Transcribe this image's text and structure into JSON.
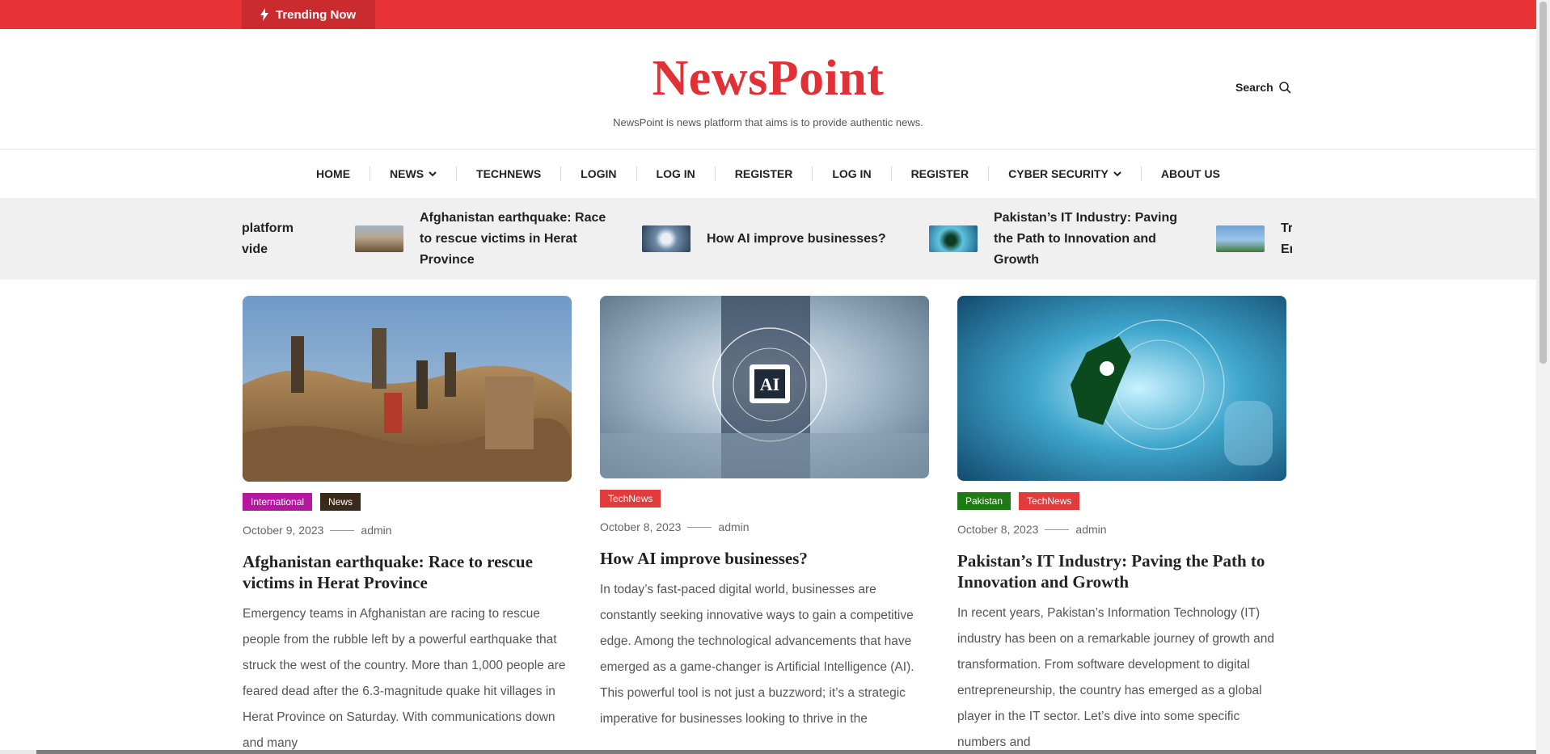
{
  "topbar": {
    "trending_label": "Trending Now",
    "accent": "#e93437"
  },
  "header": {
    "brand": "NewsPoint",
    "tagline": "NewsPoint is news platform that aims is to provide authentic news.",
    "search_label": "Search"
  },
  "nav": {
    "items": [
      {
        "label": "HOME",
        "dropdown": false
      },
      {
        "label": "NEWS",
        "dropdown": true
      },
      {
        "label": "TECHNEWS",
        "dropdown": false
      },
      {
        "label": "LOGIN",
        "dropdown": false
      },
      {
        "label": "LOG IN",
        "dropdown": false
      },
      {
        "label": "REGISTER",
        "dropdown": false
      },
      {
        "label": "LOG IN",
        "dropdown": false
      },
      {
        "label": "REGISTER",
        "dropdown": false
      },
      {
        "label": "CYBER SECURITY",
        "dropdown": true
      },
      {
        "label": "ABOUT US",
        "dropdown": false
      }
    ]
  },
  "ticker": {
    "items": [
      {
        "title_lines": [
          "platform",
          "vide"
        ]
      },
      {
        "title_lines": [
          "Afghanistan earthquake: Race",
          "to rescue victims in Herat",
          "Province"
        ]
      },
      {
        "title_lines": [
          "How AI improve businesses?"
        ]
      },
      {
        "title_lines": [
          "Pakistan’s IT Industry: Paving",
          "the Path to Innovation and",
          "Growth"
        ]
      },
      {
        "title_lines": [
          "Tr",
          "Er"
        ]
      }
    ]
  },
  "posts": [
    {
      "tags": [
        {
          "label": "International",
          "color": "#b5179e"
        },
        {
          "label": "News",
          "color": "#3a2a1a"
        }
      ],
      "date": "October 9, 2023",
      "author": "admin",
      "title": "Afghanistan earthquake: Race to rescue victims in Herat Province",
      "excerpt": "Emergency teams in Afghanistan are racing to rescue people from the rubble left by a powerful earthquake that struck the west of the country. More than 1,000 people are feared dead after the 6.3-magnitude quake hit villages in Herat Province on Saturday. With communications down and many"
    },
    {
      "tags": [
        {
          "label": "TechNews",
          "color": "#e23b3b"
        }
      ],
      "date": "October 8, 2023",
      "author": "admin",
      "title": "How AI improve businesses?",
      "excerpt": "In today’s fast-paced digital world, businesses are constantly seeking innovative ways to gain a competitive edge. Among the technological advancements that have emerged as a game-changer is Artificial Intelligence (AI). This powerful tool is not just a buzzword; it’s a strategic imperative for businesses looking to thrive in the"
    },
    {
      "tags": [
        {
          "label": "Pakistan",
          "color": "#1e7b14"
        },
        {
          "label": "TechNews",
          "color": "#e23b3b"
        }
      ],
      "date": "October 8, 2023",
      "author": "admin",
      "title": "Pakistan’s IT Industry: Paving the Path to Innovation and Growth",
      "excerpt": "In recent years, Pakistan’s Information Technology (IT) industry has been on a remarkable journey of growth and transformation. From software development to digital entrepreneurship, the country has emerged as a global player in the IT sector. Let’s dive into some specific numbers and"
    }
  ],
  "ai_image_label": "AI"
}
